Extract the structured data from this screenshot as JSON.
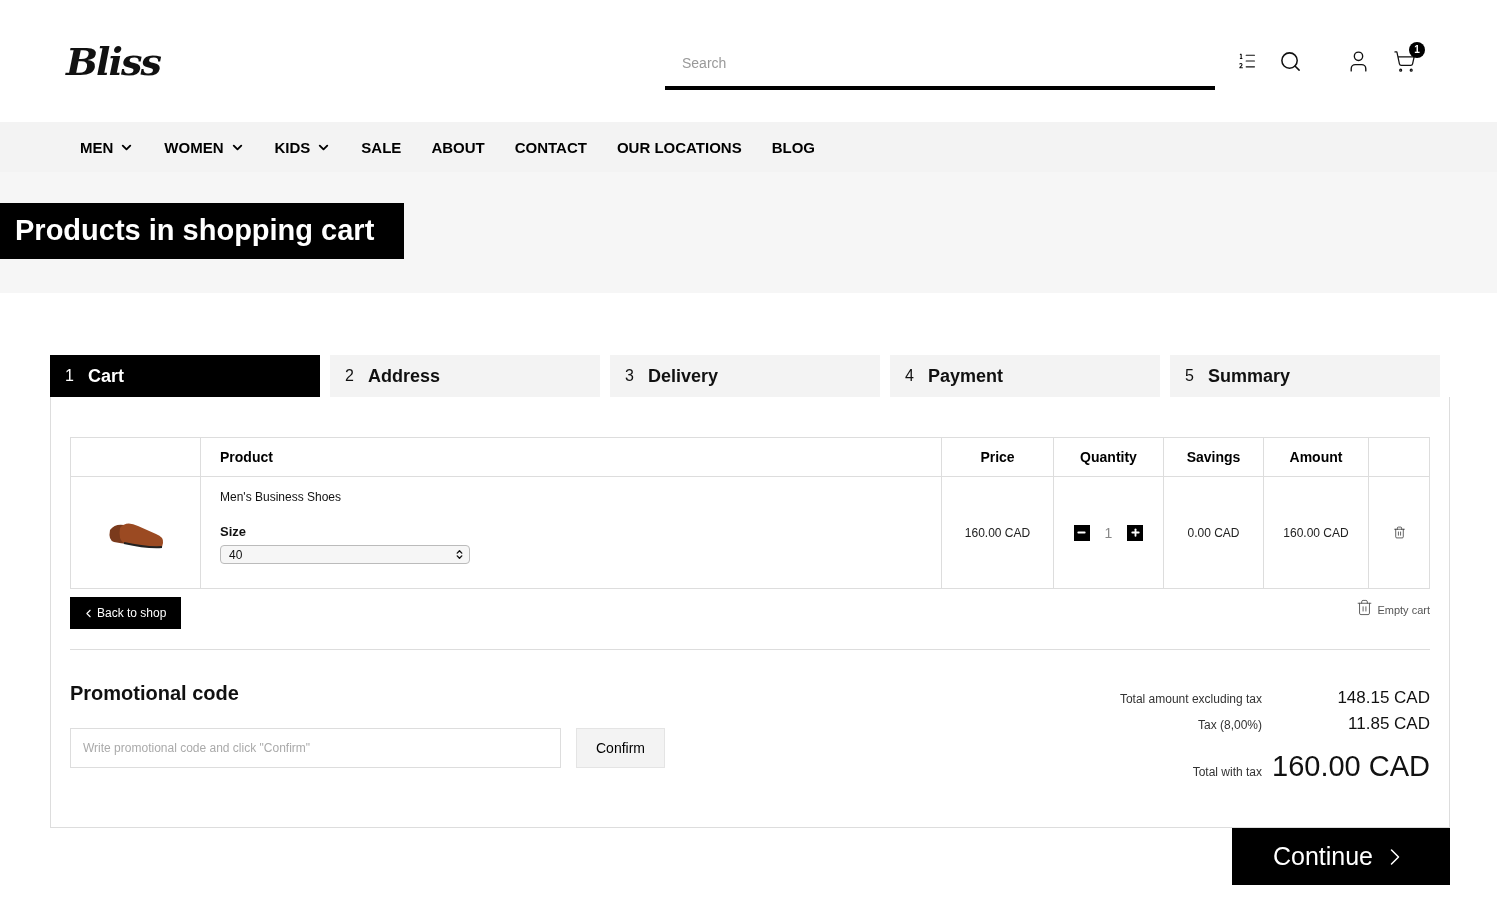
{
  "header": {
    "logo": "Bliss",
    "search": {
      "placeholder": "Search"
    },
    "cart_count": "1"
  },
  "nav": [
    {
      "label": "MEN",
      "has_dropdown": true
    },
    {
      "label": "WOMEN",
      "has_dropdown": true
    },
    {
      "label": "KIDS",
      "has_dropdown": true
    },
    {
      "label": "SALE",
      "has_dropdown": false
    },
    {
      "label": "ABOUT",
      "has_dropdown": false
    },
    {
      "label": "CONTACT",
      "has_dropdown": false
    },
    {
      "label": "OUR LOCATIONS",
      "has_dropdown": false
    },
    {
      "label": "BLOG",
      "has_dropdown": false
    }
  ],
  "page_title": "Products in shopping cart",
  "steps": [
    {
      "number": "1",
      "label": "Cart",
      "selected": true
    },
    {
      "number": "2",
      "label": "Address",
      "selected": false
    },
    {
      "number": "3",
      "label": "Delivery",
      "selected": false
    },
    {
      "number": "4",
      "label": "Payment",
      "selected": false
    },
    {
      "number": "5",
      "label": "Summary",
      "selected": false
    }
  ],
  "table": {
    "columns": [
      "Product",
      "Price",
      "Quantity",
      "Savings",
      "Amount"
    ],
    "rows": [
      {
        "name": "Men's Business Shoes",
        "size_label": "Size",
        "size": "40",
        "price": "160.00 CAD",
        "quantity": "1",
        "savings": "0.00 CAD",
        "amount": "160.00 CAD"
      }
    ]
  },
  "back_button": "Back to shop",
  "empty_cart": "Empty cart",
  "promo": {
    "title": "Promotional code",
    "placeholder": "Write promotional code and click \"Confirm\"",
    "button": "Confirm"
  },
  "totals": [
    {
      "label": "Total amount excluding tax",
      "value": "148.15 CAD",
      "kind": "normal"
    },
    {
      "label": "Tax (8,00%)",
      "value": "11.85 CAD",
      "kind": "normal"
    },
    {
      "label": "Total with tax",
      "value": "160.00 CAD",
      "kind": "grand"
    }
  ],
  "continue_button": "Continue"
}
